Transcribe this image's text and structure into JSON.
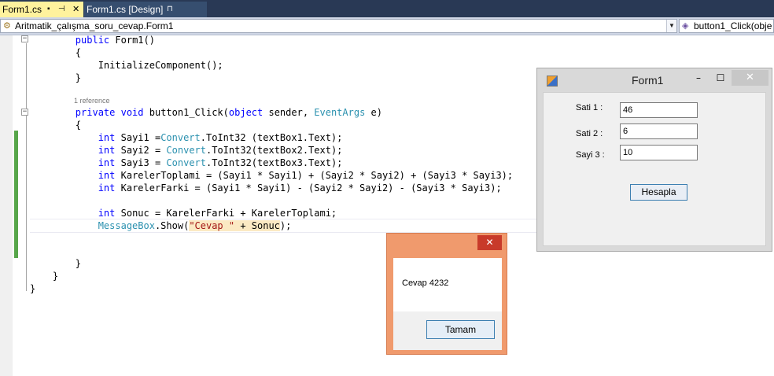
{
  "tabs": [
    {
      "label": "Form1.cs",
      "pin": "⊣",
      "close": "✕"
    },
    {
      "label": "Form1.cs [Design]",
      "pin": "⊓"
    }
  ],
  "navbar": {
    "left_combo": "Aritmatik_çalışma_soru_cevap.Form1",
    "right_combo": "button1_Click(obje",
    "dropdown_glyph": "▼"
  },
  "code": {
    "lines": [
      "        public Form1()",
      "        {",
      "            InitializeComponent();",
      "        }",
      "        private void button1_Click(object sender, EventArgs e)",
      "        {",
      "            int Sayi1 =Convert.ToInt32 (textBox1.Text);",
      "            int Sayi2 = Convert.ToInt32(textBox2.Text);",
      "            int Sayi3 = Convert.ToInt32(textBox3.Text);",
      "            int KarelerToplami = (Sayi1 * Sayi1) + (Sayi2 * Sayi2) + (Sayi3 * Sayi3);",
      "            int KarelerFarki = (Sayi1 * Sayi1) - (Sayi2 * Sayi2) - (Sayi3 * Sayi3);",
      "            int Sonuc = KarelerFarki + KarelerToplami;",
      "            MessageBox.Show(\"Cevap \" + Sonuc);",
      "        }",
      "    }",
      "}"
    ],
    "reference_hint": "1 reference",
    "fold_glyph": "−"
  },
  "form1": {
    "title": "Form1",
    "minimize": "–",
    "maximize": "☐",
    "close": "✕",
    "labels": [
      "Sati 1 :",
      "Sati 2 :",
      "Sayi 3 :"
    ],
    "values": [
      "46",
      "6",
      "10"
    ],
    "button": "Hesapla"
  },
  "messagebox": {
    "text": "Cevap 4232",
    "button": "Tamam",
    "close": "✕"
  },
  "colors": {
    "active_tab": "#fff29d",
    "tab_strip": "#293955",
    "keyword": "#0000ff",
    "type": "#2b91af",
    "string": "#a31515",
    "change_bar": "#57a64a",
    "msgbox_frame": "#f09a6d"
  }
}
